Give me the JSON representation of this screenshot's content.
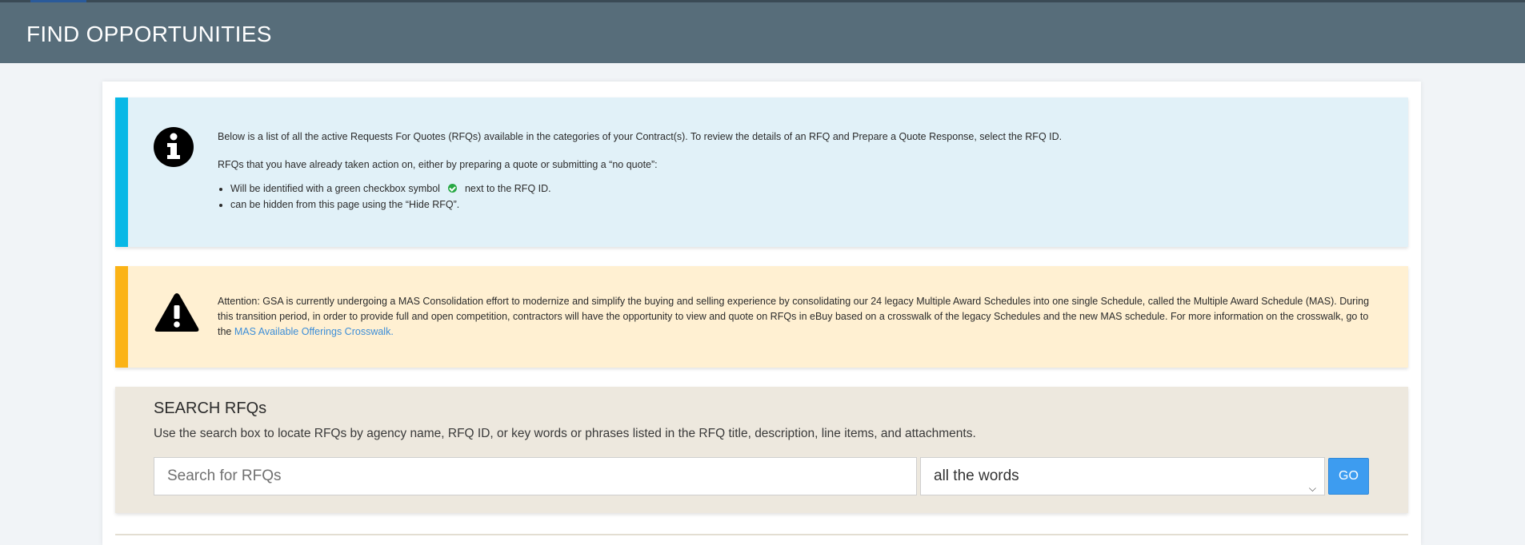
{
  "header": {
    "title": "FIND OPPORTUNITIES"
  },
  "info_alert": {
    "icon": "info-circle-icon",
    "accent_color": "#08b8e6",
    "paragraph_1": "Below is a list of all the active Requests For Quotes (RFQs) available in the categories of your Contract(s). To review the details of an RFQ and Prepare a Quote Response, select the RFQ ID.",
    "paragraph_2": "RFQs that you have already taken action on, either by preparing a quote or submitting a “no quote”:",
    "bullet_1_before": "Will be identified with a green checkbox symbol",
    "bullet_1_icon": "check-circle-icon",
    "bullet_1_after": "next to the RFQ ID.",
    "bullet_2": "can be hidden from this page using the “Hide RFQ”."
  },
  "warning_alert": {
    "icon": "warning-triangle-icon",
    "accent_color": "#fbb316",
    "text": "Attention: GSA is currently undergoing a MAS Consolidation effort to modernize and simplify the buying and selling experience by consolidating our 24 legacy Multiple Award Schedules into one single Schedule, called the Multiple Award Schedule (MAS). During this transition period, in order to provide full and open competition, contractors will have the opportunity to view and quote on RFQs in eBuy based on a crosswalk of the legacy Schedules and the new MAS schedule. For more information on the crosswalk, go to the",
    "link_text": "MAS Available Offerings Crosswalk."
  },
  "search": {
    "title": "SEARCH RFQs",
    "description": "Use the search box to locate RFQs by agency name, RFQ ID, or key words or phrases listed in the RFQ title, description, line items, and attachments.",
    "placeholder": "Search for RFQs",
    "value": "",
    "mode_selected": "all the words",
    "go_label": "GO",
    "go_color": "#3d9cf0"
  }
}
